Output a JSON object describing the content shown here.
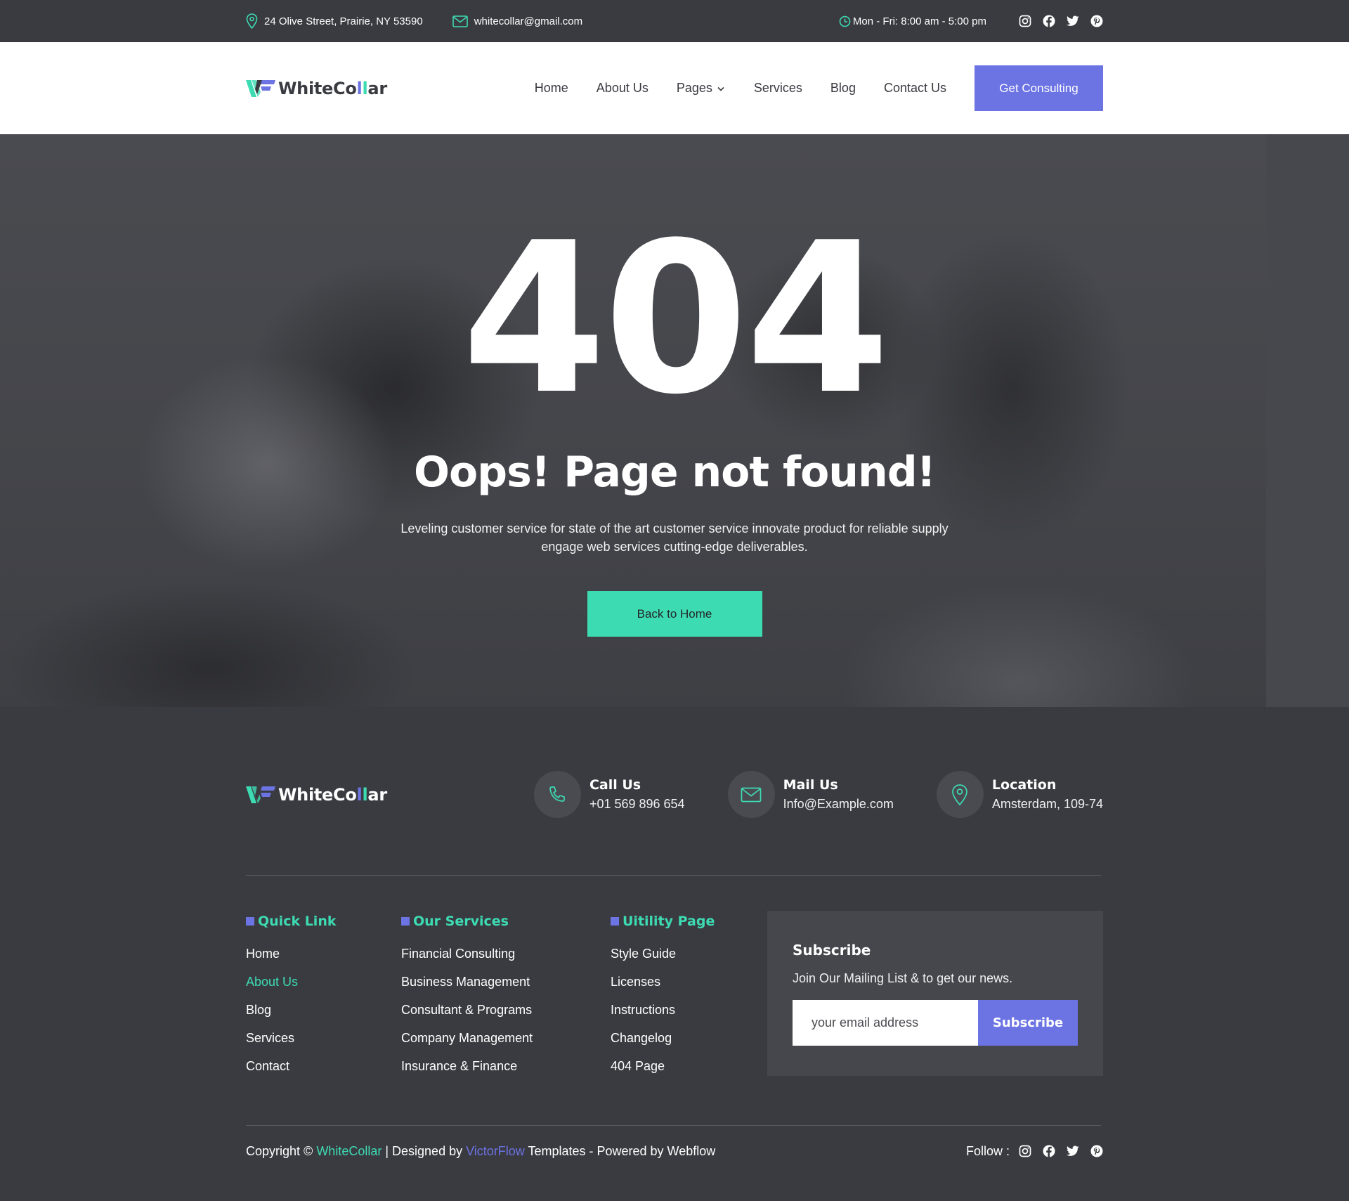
{
  "topbar": {
    "address": "24 Olive Street, Prairie, NY 53590",
    "email": "whitecollar@gmail.com",
    "hours": "Mon - Fri: 8:00 am - 5:00 pm",
    "socials": [
      "instagram-icon",
      "facebook-icon",
      "twitter-icon",
      "pinterest-icon"
    ]
  },
  "brand": {
    "part1": "WhiteCo",
    "part2": "l",
    "part3": "l",
    "part4": "ar",
    "colors": {
      "primary": "#6c73e3",
      "accent": "#3ddbb2",
      "dark": "#3a3b41"
    }
  },
  "nav": {
    "links": [
      "Home",
      "About Us",
      "Pages",
      "Services",
      "Blog",
      "Contact Us"
    ],
    "cta": "Get Consulting"
  },
  "hero": {
    "code": "404",
    "title": "Oops! Page not found!",
    "description_line1": "Leveling customer service for state of the art  customer service innovate product  for reliable supply",
    "description_line2": "engage web services cutting-edge deliverables.",
    "button": "Back to Home"
  },
  "footer": {
    "contacts": [
      {
        "title": "Call Us",
        "value": "+01 569 896 654",
        "icon": "phone-icon"
      },
      {
        "title": "Mail Us",
        "value": "Info@Example.com",
        "icon": "mail-icon"
      },
      {
        "title": "Location",
        "value": "Amsterdam, 109-74",
        "icon": "location-pin-icon"
      }
    ],
    "quick_link": {
      "title": "Quick Link",
      "items": [
        "Home",
        "About Us",
        "Blog",
        "Services",
        "Contact"
      ],
      "active": "About Us"
    },
    "services": {
      "title": "Our Services",
      "items": [
        "Financial Consulting",
        "Business Management",
        "Consultant & Programs",
        "Company Management",
        "Insurance & Finance"
      ]
    },
    "utility": {
      "title": "Uitility Page",
      "items": [
        "Style Guide",
        "Licenses",
        "Instructions",
        "Changelog",
        "404 Page"
      ]
    },
    "subscribe": {
      "title": "Subscribe",
      "text": "Join Our Mailing List & to get our news.",
      "placeholder": "your email address",
      "button": "Subscribe"
    },
    "bottom": {
      "copy_prefix": "Copyright © ",
      "brand": "WhiteCollar",
      "designed": " | Designed by ",
      "designer": "VictorFlow",
      "suffix": " Templates - Powered by Webflow",
      "follow": "Follow :"
    }
  }
}
